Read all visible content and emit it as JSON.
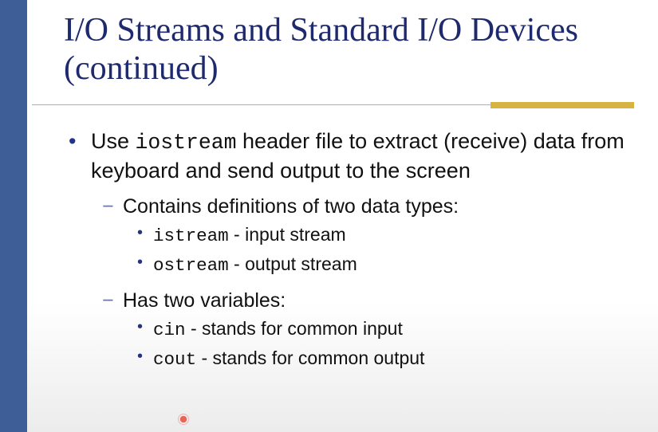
{
  "title": "I/O Streams and Standard I/O Devices (continued)",
  "bullets": {
    "b1": {
      "pre": "Use ",
      "code": "iostream",
      "post": " header file to extract (receive) data from keyboard and send output to the screen"
    },
    "b2a": "Contains definitions of two data types:",
    "b3a": {
      "code": "istream",
      "post": " - input stream"
    },
    "b3b": {
      "code": "ostream",
      "post": " - output stream"
    },
    "b2b": "Has two variables:",
    "b3c": {
      "code": "cin",
      "post": " - stands for common input"
    },
    "b3d": {
      "code": "cout",
      "post": " - stands for common output"
    }
  }
}
